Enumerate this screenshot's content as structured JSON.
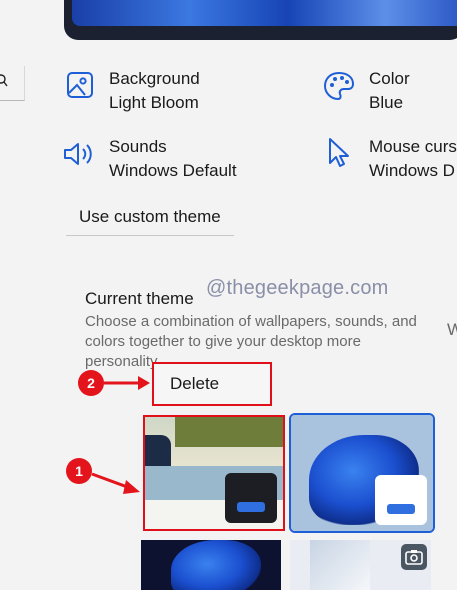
{
  "personalize": {
    "items": [
      {
        "title": "Background",
        "value": "Light Bloom",
        "icon": "image-icon"
      },
      {
        "title": "Color",
        "value": "Blue",
        "icon": "palette-icon"
      },
      {
        "title": "Sounds",
        "value": "Windows Default",
        "icon": "speaker-icon"
      },
      {
        "title": "Mouse curs",
        "value": "Windows D",
        "icon": "cursor-icon"
      }
    ],
    "custom_theme_button": "Use custom theme"
  },
  "current_theme": {
    "title": "Current theme",
    "description": "Choose a combination of wallpapers, sounds, and colors together to give your desktop more personality",
    "right_fragment": "W"
  },
  "context_menu": {
    "delete_label": "Delete"
  },
  "annotations": {
    "step1": "1",
    "step2": "2",
    "watermark": "@thegeekpage.com",
    "highlight_color": "#e3141b"
  },
  "themes": [
    {
      "name": "beach-theme",
      "selected": false
    },
    {
      "name": "light-bloom-theme",
      "selected": true
    },
    {
      "name": "dark-bloom-theme",
      "selected": false
    },
    {
      "name": "glow-theme",
      "selected": false
    }
  ],
  "colors": {
    "accent": "#1f5fd6",
    "background": "#f3f3f3"
  }
}
